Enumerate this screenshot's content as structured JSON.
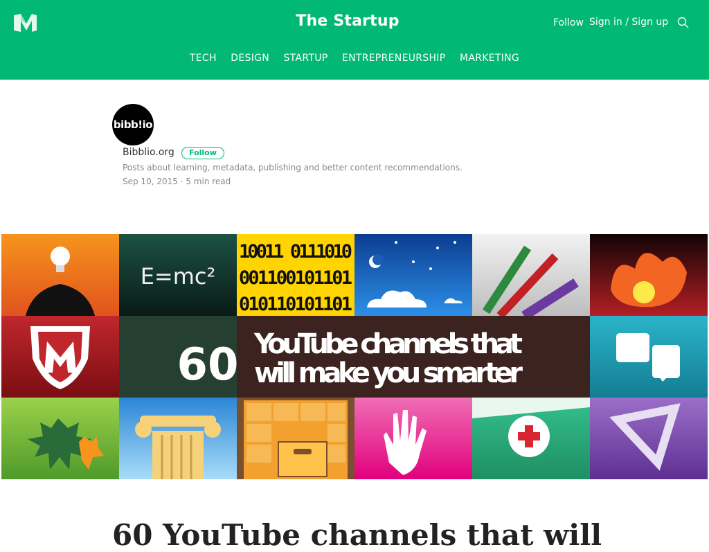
{
  "header": {
    "publication_title": "The Startup",
    "follow_label": "Follow",
    "signin_label": "Sign in / Sign up",
    "nav": [
      "TECH",
      "DESIGN",
      "STARTUP",
      "ENTREPRENEURSHIP",
      "MARKETING"
    ]
  },
  "author": {
    "avatar_text": "bibb!io",
    "name": "Bibblio.org",
    "follow_label": "Follow",
    "bio": "Posts about learning, metadata, publishing and better content recommendations.",
    "date": "Sep 10, 2015",
    "read_time": "5 min read"
  },
  "hero": {
    "number": "60",
    "line1": "YouTube channels that",
    "line2": "will make you smarter",
    "formula": "E=mc²",
    "binary": [
      "10011 0111010",
      "001100101101",
      "010110101101"
    ]
  },
  "article": {
    "title": "60 YouTube channels that will"
  },
  "colors": {
    "brand": "#02b875"
  }
}
